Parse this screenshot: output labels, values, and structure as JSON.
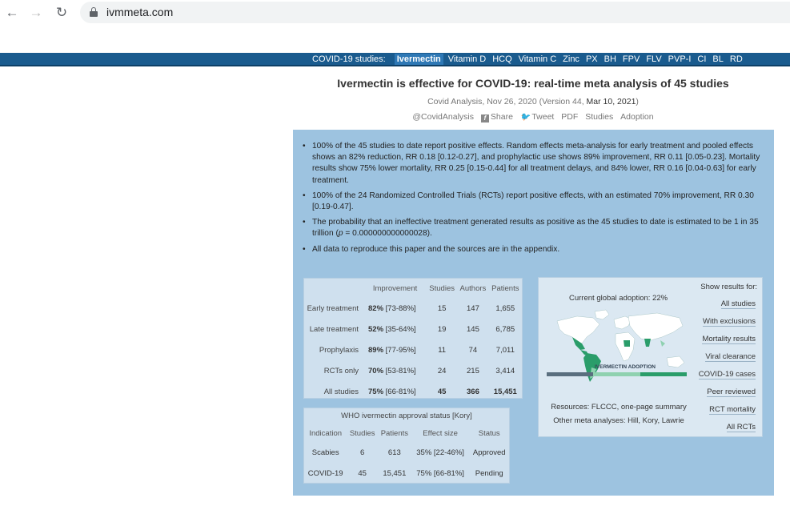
{
  "browser": {
    "url": "ivmmeta.com",
    "icons": [
      "back-arrow-icon",
      "forward-arrow-icon",
      "reload-icon",
      "lock-icon"
    ]
  },
  "topnav": {
    "lead": "COVID-19 studies:",
    "items": [
      "Ivermectin",
      "Vitamin D",
      "HCQ",
      "Vitamin C",
      "Zinc",
      "PX",
      "BH",
      "FPV",
      "FLV",
      "PVP-I",
      "CI",
      "BL",
      "RD"
    ],
    "active": "Ivermectin"
  },
  "header": {
    "title": "Ivermectin is effective for COVID-19: real-time meta analysis of 45 studies",
    "byline": "Covid Analysis, Nov 26, 2020 (Version 44, ",
    "byline_date": "Mar 10, 2021",
    "byline_end": ")",
    "links": {
      "handle": "@CovidAnalysis",
      "share": "Share",
      "tweet": "Tweet",
      "pdf": "PDF",
      "studies": "Studies",
      "adoption": "Adoption"
    }
  },
  "bullets": [
    "100% of the 45 studies to date report positive effects. Random effects meta-analysis for early treatment and pooled effects shows an 82% reduction, RR 0.18 [0.12-0.27], and prophylactic use shows 89% improvement, RR 0.11 [0.05-0.23]. Mortality results show 75% lower mortality, RR 0.25 [0.15-0.44] for all treatment delays, and 84% lower, RR 0.16 [0.04-0.63] for early treatment.",
    "100% of the 24 Randomized Controlled Trials (RCTs) report positive effects, with an estimated 70% improvement, RR 0.30 [0.19-0.47].",
    "The probability that an ineffective treatment generated results as positive as the 45 studies to date is estimated to be 1 in 35 trillion (p = 0.000000000000028).",
    "All data to reproduce this paper and the sources are in the appendix."
  ],
  "results_table": {
    "headers": [
      "",
      "Improvement",
      "Studies",
      "Authors",
      "Patients"
    ],
    "rows": [
      {
        "label": "Early treatment",
        "imp": "82%",
        "ci": "[73-88%]",
        "studies": "15",
        "authors": "147",
        "patients": "1,655"
      },
      {
        "label": "Late treatment",
        "imp": "52%",
        "ci": "[35-64%]",
        "studies": "19",
        "authors": "145",
        "patients": "6,785"
      },
      {
        "label": "Prophylaxis",
        "imp": "89%",
        "ci": "[77-95%]",
        "studies": "11",
        "authors": "74",
        "patients": "7,011"
      },
      {
        "label": "RCTs only",
        "imp": "70%",
        "ci": "[53-81%]",
        "studies": "24",
        "authors": "215",
        "patients": "3,414"
      },
      {
        "label": "All studies",
        "imp": "75%",
        "ci": "[66-81%]",
        "studies": "45",
        "authors": "366",
        "patients": "15,451"
      }
    ]
  },
  "who_table": {
    "title": "WHO ivermectin approval status [Kory]",
    "headers": [
      "Indication",
      "Studies",
      "Patients",
      "Effect size",
      "Status"
    ],
    "rows": [
      [
        "Scabies",
        "6",
        "613",
        "35% [22-46%]",
        "Approved"
      ],
      [
        "COVID-19",
        "45",
        "15,451",
        "75% [66-81%]",
        "Pending"
      ]
    ]
  },
  "adoption": {
    "caption": "Current global adoption: 22%",
    "legend_title": "IVERMECTIN ADOPTION",
    "resources": "Resources: FLCCC, one-page summary",
    "other": "Other meta analyses: Hill, Kory, Lawrie",
    "show_title": "Show results for:",
    "show_items": [
      "All studies",
      "With exclusions",
      "Mortality results",
      "Viral clearance",
      "COVID-19 cases",
      "Peer reviewed",
      "RCT mortality",
      "All RCTs"
    ],
    "colors": {
      "adopted": "#2a9d6a",
      "partial": "#8fd1b0",
      "none": "#ffffff",
      "ocean": "#dbe8f2"
    }
  }
}
